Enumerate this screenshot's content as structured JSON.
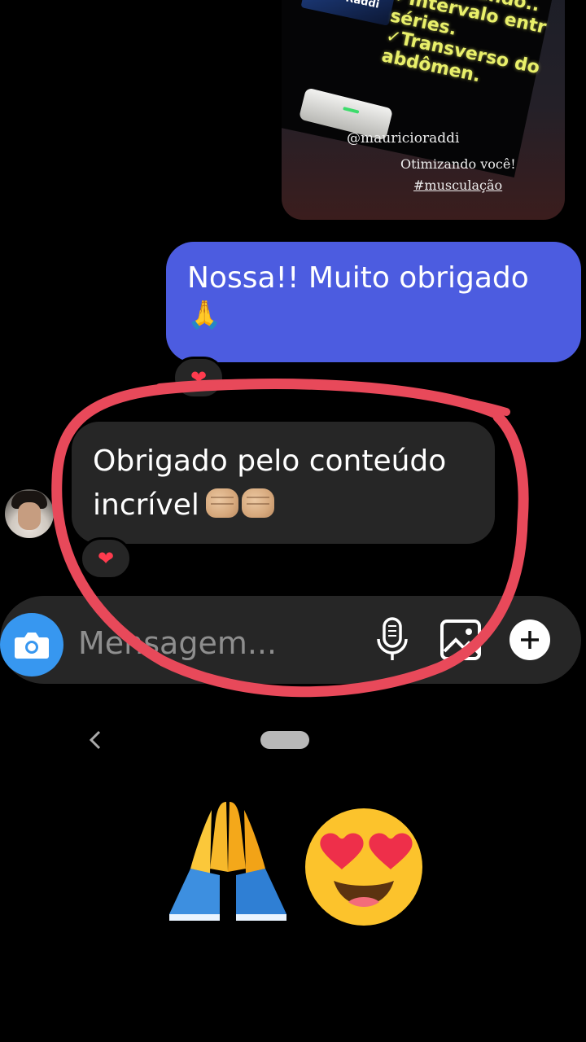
{
  "shared_story": {
    "checklist_lines": "Seleção do p\n✓Otimizando..\n✓Intervalo entr\nséries.\n✓Transverso do\nabdômen.",
    "presenter": "f. Maurício Raddi",
    "handle": "@mauricioraddi",
    "slogan": "Otimizando você!",
    "hashtag": "#musculação"
  },
  "messages": {
    "sent": {
      "text": "Nossa!! Muito obrigado",
      "emoji": "🙏",
      "reaction": "❤"
    },
    "received": {
      "text_line1": "Obrigado pelo conteúdo",
      "text_line2": "incrível",
      "reaction": "❤"
    }
  },
  "composer": {
    "placeholder": "Mensagem...",
    "camera_icon": "camera-icon",
    "mic_icon": "microphone-icon",
    "gallery_icon": "gallery-icon",
    "plus_icon": "plus-icon"
  },
  "annotation": {
    "color": "#e8495a"
  },
  "colors": {
    "sent_bubble": "#4c5ce0",
    "received_bubble": "#262626",
    "camera_button": "#3797f0",
    "background": "#000000"
  }
}
